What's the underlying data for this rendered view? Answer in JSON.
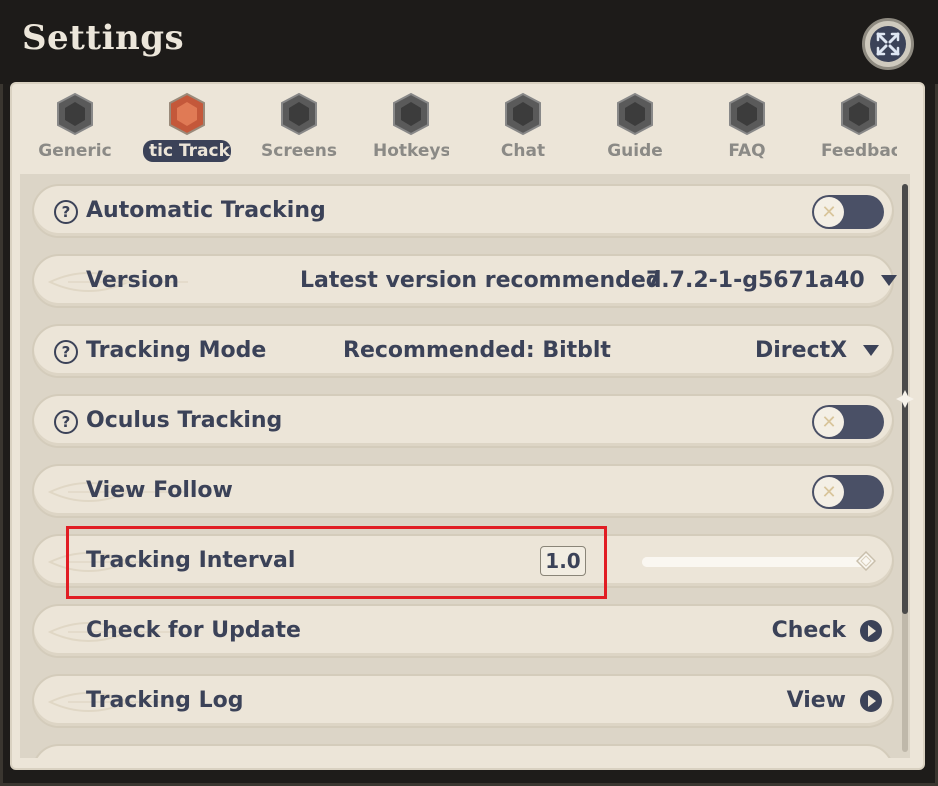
{
  "window": {
    "title": "Settings"
  },
  "tabs": [
    {
      "label": "Generic",
      "active": false
    },
    {
      "label": "tic Track",
      "active": true
    },
    {
      "label": "Screensh",
      "active": false
    },
    {
      "label": "Hotkeys",
      "active": false
    },
    {
      "label": "Chat",
      "active": false
    },
    {
      "label": "Guide",
      "active": false
    },
    {
      "label": "FAQ",
      "active": false
    },
    {
      "label": "Feedback",
      "active": false
    }
  ],
  "settings": {
    "automatic_tracking": {
      "label": "Automatic Tracking",
      "enabled": false
    },
    "version": {
      "label": "Version",
      "hint": "Latest version recommended",
      "value": "7.7.2-1-g5671a40"
    },
    "tracking_mode": {
      "label": "Tracking Mode",
      "hint": "Recommended: Bitblt",
      "value": "DirectX"
    },
    "oculus_tracking": {
      "label": "Oculus Tracking",
      "enabled": false
    },
    "view_follow": {
      "label": "View Follow",
      "enabled": false
    },
    "tracking_interval": {
      "label": "Tracking Interval",
      "value": "1.0",
      "slider_fraction": 1.0
    },
    "check_update": {
      "label": "Check for Update",
      "action": "Check"
    },
    "tracking_log": {
      "label": "Tracking Log",
      "action": "View"
    }
  },
  "icons": {
    "help": "?",
    "toggle_off": "✕"
  },
  "colors": {
    "accent": "#3b4258",
    "panel": "#ece5d8",
    "highlight": "#e11d24",
    "active_gem": "#c4583a"
  }
}
